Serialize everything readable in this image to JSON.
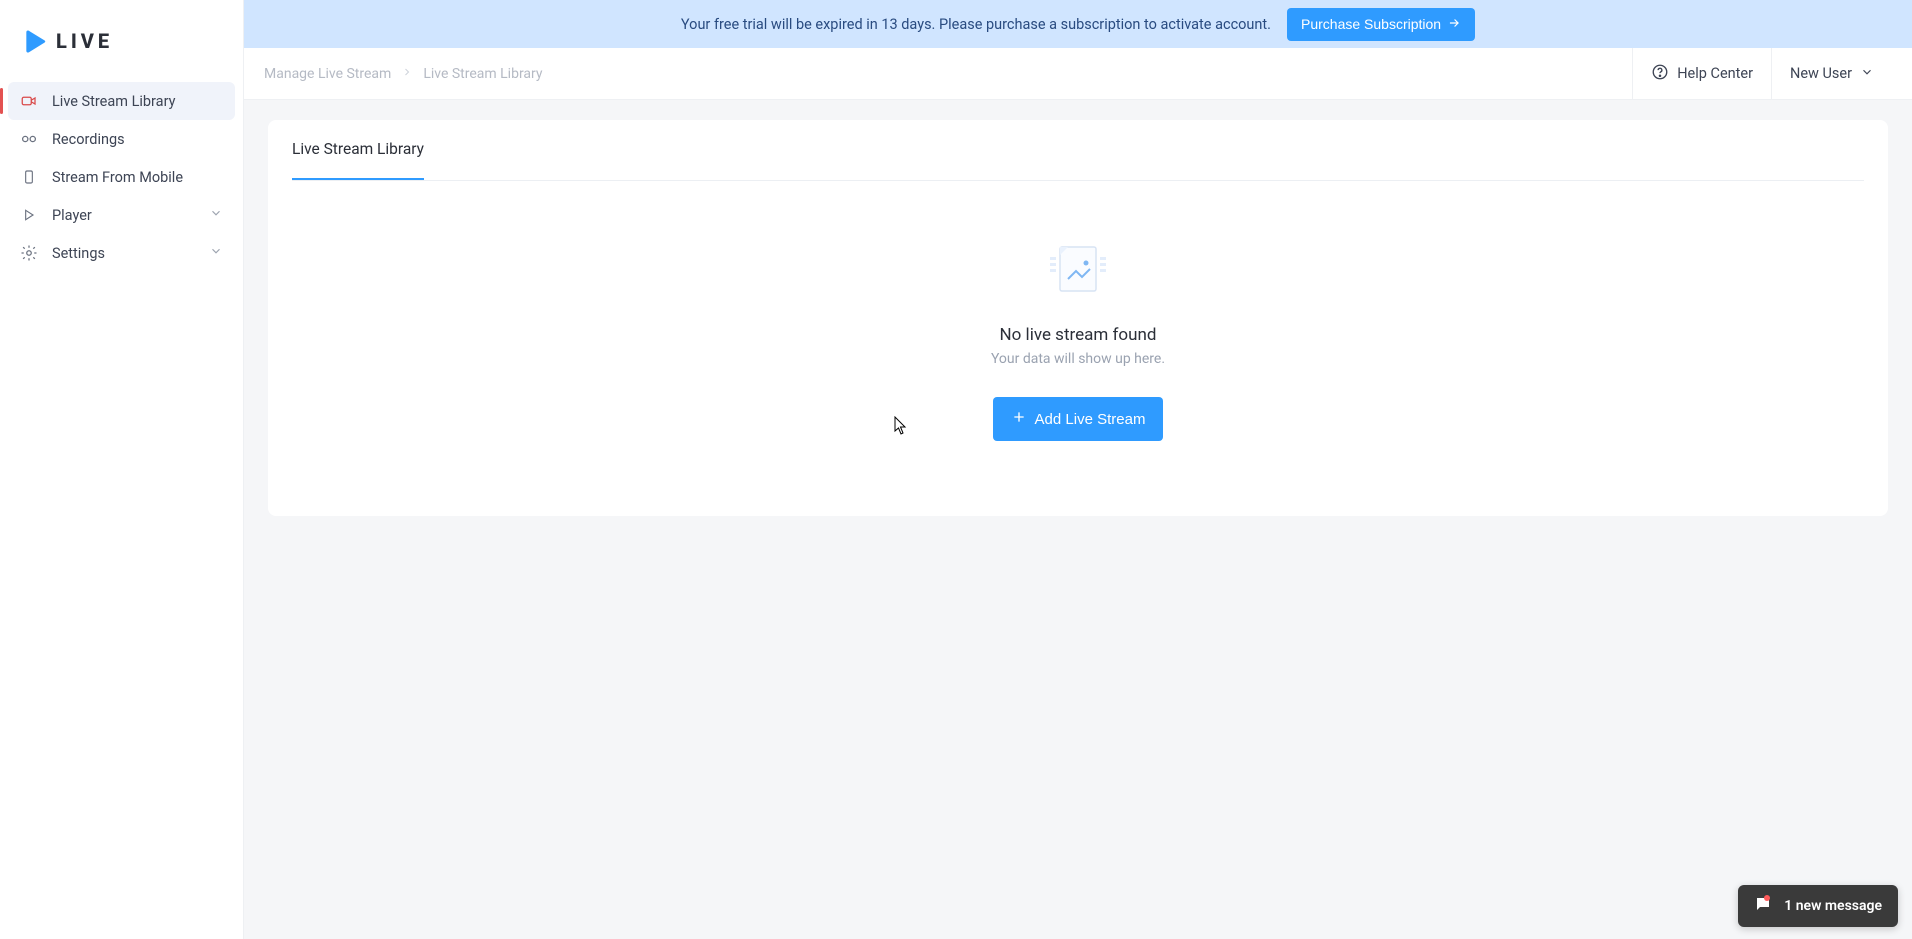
{
  "brand": {
    "name": "LIVE"
  },
  "sidebar": {
    "items": [
      {
        "label": "Live Stream Library"
      },
      {
        "label": "Recordings"
      },
      {
        "label": "Stream From Mobile"
      },
      {
        "label": "Player"
      },
      {
        "label": "Settings"
      }
    ]
  },
  "banner": {
    "message": "Your free trial will be expired in 13 days. Please purchase a subscription to activate account.",
    "button": "Purchase Subscription"
  },
  "breadcrumbs": {
    "root": "Manage Live Stream",
    "current": "Live Stream Library"
  },
  "header": {
    "help": "Help Center",
    "user": "New User"
  },
  "tabs": {
    "library": "Live Stream Library"
  },
  "empty": {
    "title": "No live stream found",
    "subtitle": "Your data will show up here.",
    "button": "Add Live Stream"
  },
  "chat": {
    "text": "1 new message"
  }
}
